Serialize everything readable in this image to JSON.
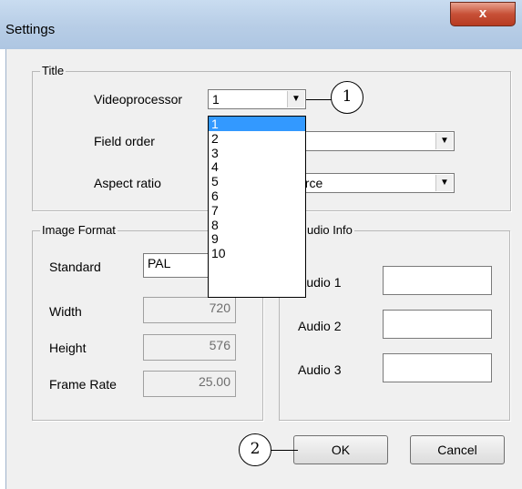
{
  "window": {
    "title": "Settings",
    "close_glyph": "x"
  },
  "title_group": {
    "label": "Title",
    "videoprocessor": {
      "label": "Videoprocessor",
      "value": "1"
    },
    "field_order": {
      "label": "Field order",
      "value": ""
    },
    "aspect_ratio": {
      "label": "Aspect ratio",
      "value": "urce"
    }
  },
  "videoprocessor_options": [
    "1",
    "2",
    "3",
    "4",
    "5",
    "6",
    "7",
    "8",
    "9",
    "10"
  ],
  "image_format": {
    "label": "Image Format",
    "standard": {
      "label": "Standard",
      "value": "PAL"
    },
    "width": {
      "label": "Width",
      "value": "720"
    },
    "height": {
      "label": "Height",
      "value": "576"
    },
    "frame_rate": {
      "label": "Frame Rate",
      "value": "25.00"
    }
  },
  "audio_info": {
    "label": "udio Info",
    "audio1": {
      "label": "Audio 1",
      "value": ""
    },
    "audio2": {
      "label": "Audio 2",
      "value": ""
    },
    "audio3": {
      "label": "Audio 3",
      "value": ""
    }
  },
  "buttons": {
    "ok": "OK",
    "cancel": "Cancel"
  },
  "callouts": {
    "one": "1",
    "two": "2"
  }
}
